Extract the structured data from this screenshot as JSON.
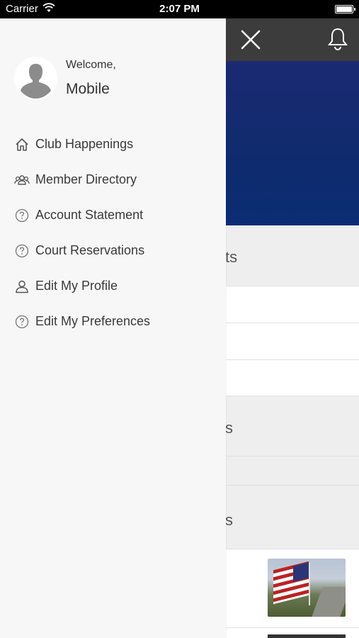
{
  "status_bar": {
    "carrier": "Carrier",
    "time": "2:07 PM"
  },
  "drawer": {
    "welcome": "Welcome,",
    "user_name": "Mobile",
    "menu": [
      {
        "label": "Club Happenings",
        "icon": "home-icon"
      },
      {
        "label": "Member Directory",
        "icon": "group-icon"
      },
      {
        "label": "Account Statement",
        "icon": "question-circle-icon"
      },
      {
        "label": "Court Reservations",
        "icon": "question-circle-icon"
      },
      {
        "label": "Edit My Profile",
        "icon": "person-icon"
      },
      {
        "label": "Edit My Preferences",
        "icon": "question-circle-icon"
      }
    ]
  },
  "background": {
    "row1_fragment": "ts",
    "row2_fragment": "s",
    "row3_fragment": "s"
  }
}
